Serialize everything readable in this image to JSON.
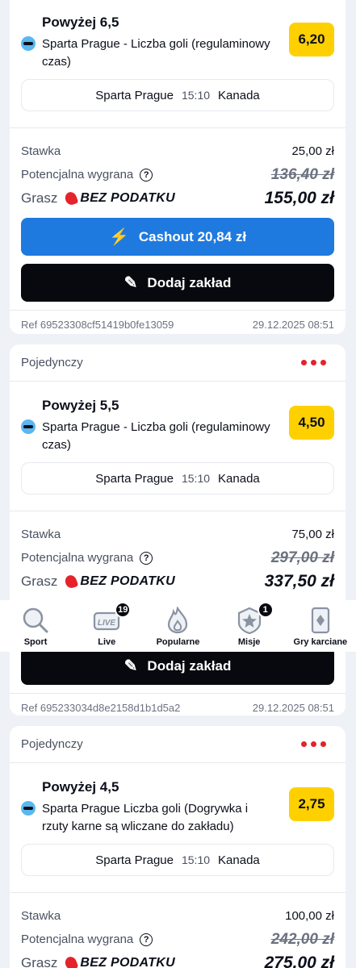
{
  "cards": [
    {
      "type_label": "",
      "title": "Powyżej 6,5",
      "market": "Sparta Prague - Liczba goli (regulaminowy czas)",
      "odds": "6,20",
      "home": "Sparta Prague",
      "time": "15:10",
      "away": "Kanada",
      "stake_label": "Stawka",
      "stake": "25,00 zł",
      "potential_label": "Potencjalna wygrana",
      "potential_old": "136,40 zł",
      "grasz_label": "Grasz",
      "bez_label": "BEZ PODATKU",
      "potential_new": "155,00 zł",
      "cashout_label": "Cashout 20,84 zł",
      "add_label": "Dodaj zakład",
      "ref": "Ref 69523308cf51419b0fe13059",
      "date": "29.12.2025 08:51"
    },
    {
      "type_label": "Pojedynczy",
      "title": "Powyżej 5,5",
      "market": "Sparta Prague - Liczba goli (regulaminowy czas)",
      "odds": "4,50",
      "home": "Sparta Prague",
      "time": "15:10",
      "away": "Kanada",
      "stake_label": "Stawka",
      "stake": "75,00 zł",
      "potential_label": "Potencjalna wygrana",
      "potential_old": "297,00 zł",
      "grasz_label": "Grasz",
      "bez_label": "BEZ PODATKU",
      "potential_new": "337,50 zł",
      "add_label": "Dodaj zakład",
      "ref": "Ref 695233034d8e2158d1b1d5a2",
      "date": "29.12.2025 08:51"
    },
    {
      "type_label": "Pojedynczy",
      "title": "Powyżej 4,5",
      "market": "Sparta Prague Liczba goli (Dogrywka i rzuty karne są wliczane do zakładu)",
      "odds": "2,75",
      "home": "Sparta Prague",
      "time": "15:10",
      "away": "Kanada",
      "stake_label": "Stawka",
      "stake": "100,00 zł",
      "potential_label": "Potencjalna wygrana",
      "potential_old": "242,00 zł",
      "grasz_label": "Grasz",
      "bez_label": "BEZ PODATKU",
      "potential_new": "275,00 zł"
    }
  ],
  "tabbar": {
    "items": [
      {
        "label": "Sport",
        "icon": "search-icon"
      },
      {
        "label": "Live",
        "icon": "live-icon",
        "badge": "19"
      },
      {
        "label": "Popularne",
        "icon": "flame-icon"
      },
      {
        "label": "Misje",
        "icon": "star-badge-icon",
        "badge": "1"
      },
      {
        "label": "Gry karciane",
        "icon": "cards-icon"
      }
    ]
  },
  "colors": {
    "accent_yellow": "#ffd000",
    "cashout_blue": "#1f7ae0",
    "brand_red": "#e4232b",
    "dark": "#07090f"
  }
}
